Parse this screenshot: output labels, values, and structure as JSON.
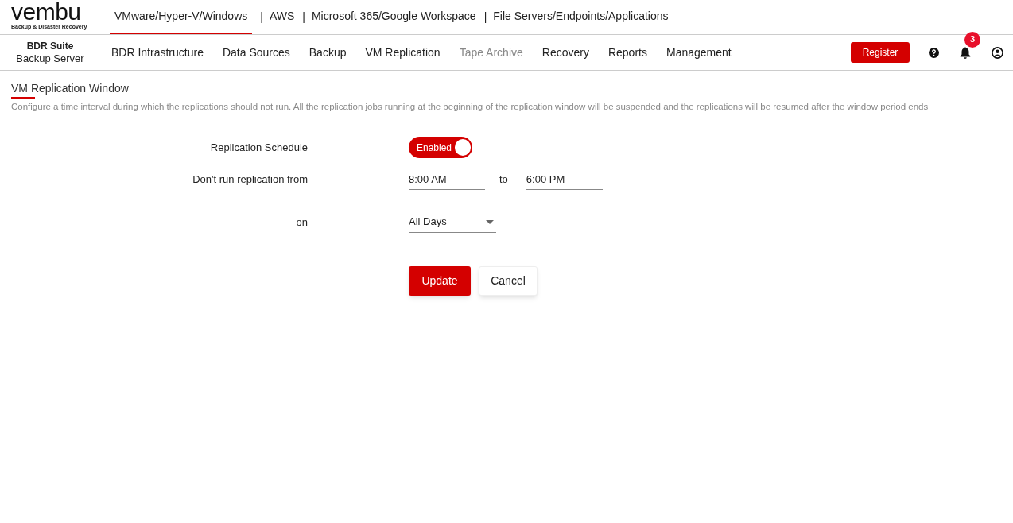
{
  "logo": {
    "wordmark": "vembu",
    "tagline": "Backup & Disaster Recovery"
  },
  "product_tabs": [
    {
      "label": "VMware/Hyper-V/Windows",
      "selected": true
    },
    {
      "label": "AWS",
      "separator": "|",
      "selected": false
    },
    {
      "label": "Microsoft 365/Google Workspace",
      "separator": "|",
      "selected": false
    },
    {
      "label": "File Servers/Endpoints/Applications",
      "separator": "|",
      "selected": false
    }
  ],
  "suite": {
    "title": "BDR Suite",
    "subtitle": "Backup Server"
  },
  "nav": [
    {
      "label": "BDR Infrastructure",
      "disabled": false
    },
    {
      "label": "Data Sources",
      "disabled": false
    },
    {
      "label": "Backup",
      "disabled": false
    },
    {
      "label": "VM Replication",
      "disabled": false
    },
    {
      "label": "Tape Archive",
      "disabled": true
    },
    {
      "label": "Recovery",
      "disabled": false
    },
    {
      "label": "Reports",
      "disabled": false
    },
    {
      "label": "Management",
      "disabled": false
    }
  ],
  "register_button": "Register",
  "notifications_count": "3",
  "page": {
    "title": "VM Replication Window",
    "description": "Configure a time interval during which the replications should not run. All the replication jobs running at the beginning of the replication window will be suspended and the replications will be resumed after the window period ends"
  },
  "form": {
    "schedule_label": "Replication Schedule",
    "schedule_toggle": {
      "label": "Enabled",
      "on": true
    },
    "from_label": "Don't run replication from",
    "from_value": "8:00 AM",
    "to_label": "to",
    "to_value": "6:00 PM",
    "on_label": "on",
    "days_value": "All Days"
  },
  "buttons": {
    "update": "Update",
    "cancel": "Cancel"
  }
}
